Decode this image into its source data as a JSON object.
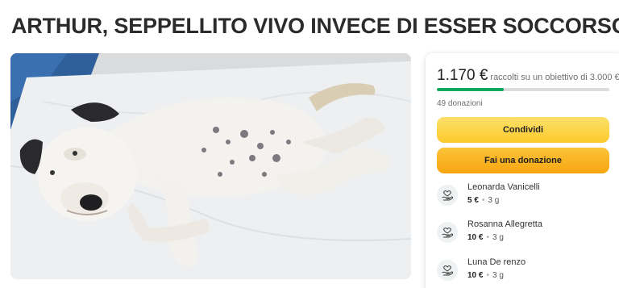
{
  "campaign": {
    "title": "ARTHUR, SEPPELLITO VIVO INVECE DI ESSER SOCCORSO"
  },
  "funding": {
    "raised": "1.170 €",
    "goal_text": "raccolti su un obiettivo di 3.000 €",
    "progress_fraction": 0.39,
    "donations_count": "49 donazioni"
  },
  "actions": {
    "share_label": "Condividi",
    "donate_label": "Fai una donazione"
  },
  "donors": [
    {
      "name": "Leonarda Vanicelli",
      "amount": "5 €",
      "time": "3 g"
    },
    {
      "name": "Rosanna Allegretta",
      "amount": "10 €",
      "time": "3 g"
    },
    {
      "name": "Luna De renzo",
      "amount": "10 €",
      "time": "3 g"
    }
  ],
  "icons": {
    "donor": "heart-hand-icon"
  },
  "colors": {
    "progress": "#02a95c",
    "share_button": "#fcd23a",
    "donate_button": "#f9b31b"
  }
}
